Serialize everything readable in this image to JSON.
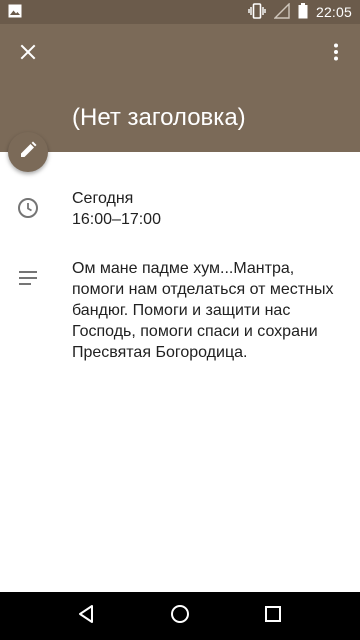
{
  "status_bar": {
    "time": "22:05",
    "icons": [
      "image-icon",
      "vibrate-icon",
      "signal-icon",
      "battery-icon"
    ]
  },
  "header": {
    "title": "(Нет заголовка)",
    "background": "#7b6a58",
    "close_icon": "close-icon",
    "more_icon": "more-vert-icon"
  },
  "event": {
    "date": "Сегодня",
    "time_range": "16:00–17:00",
    "description": "Ом мане падме хум...Мантра, помоги нам отделаться от местных бандюг. Помоги и защити нас Господь, помоги спаси и сохрани Пресвятая Богородица."
  },
  "fab": {
    "icon": "edit-pencil-icon"
  },
  "nav": {
    "icons": [
      "back-icon",
      "home-icon",
      "recents-icon"
    ]
  }
}
